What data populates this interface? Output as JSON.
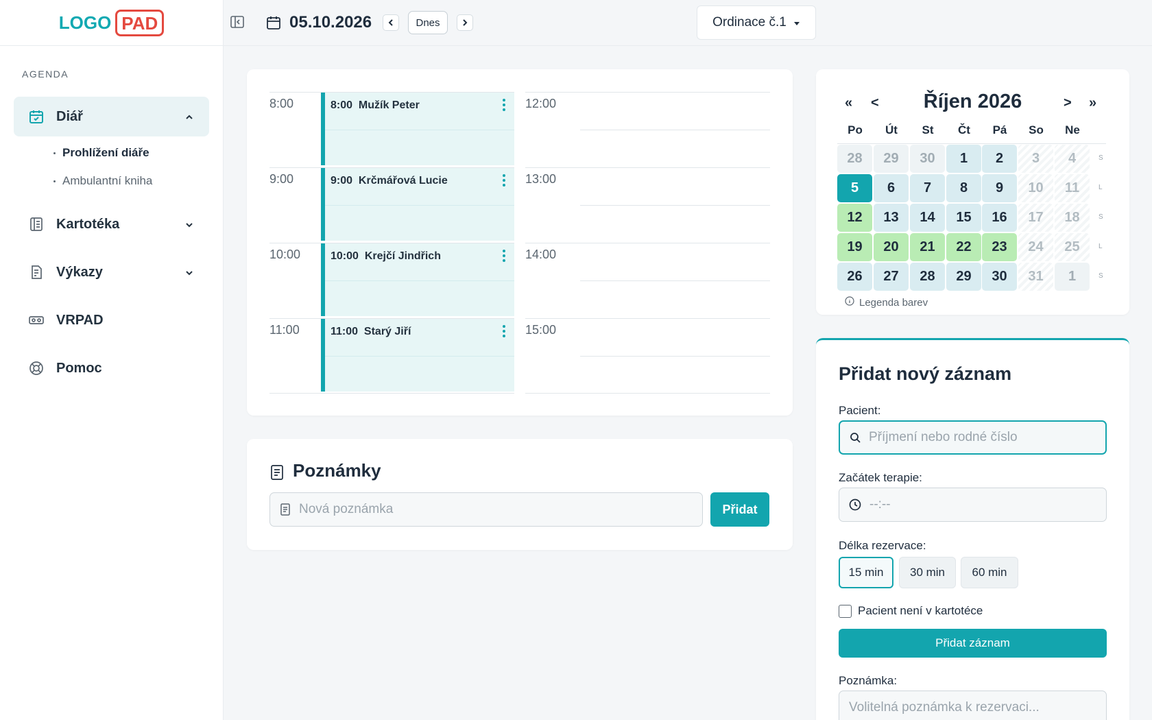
{
  "brand": {
    "logo_part1": "LOGO",
    "logo_part2": "PAD"
  },
  "sidebar": {
    "section_label": "AGENDA",
    "items": [
      {
        "label": "Diář",
        "icon": "calendar-check-icon",
        "expanded": true
      },
      {
        "label": "Kartotéka",
        "icon": "book-icon"
      },
      {
        "label": "Výkazy",
        "icon": "report-icon"
      },
      {
        "label": "VRPAD",
        "icon": "vr-headset-icon"
      },
      {
        "label": "Pomoc",
        "icon": "lifebuoy-icon"
      }
    ],
    "subitems": [
      {
        "label": "Prohlížení diáře",
        "current": true
      },
      {
        "label": "Ambulantní kniha"
      }
    ]
  },
  "topbar": {
    "date": "05.10.2026",
    "today_label": "Dnes",
    "office_select": "Ordinace č.1"
  },
  "schedule": {
    "left": [
      {
        "time": "8:00",
        "appointment": "8:00  Mužík Peter"
      },
      {
        "time": "9:00",
        "appointment": "9:00  Krčmářová Lucie"
      },
      {
        "time": "10:00",
        "appointment": "10:00  Krejčí Jindřich"
      },
      {
        "time": "11:00",
        "appointment": "11:00  Starý Jiří"
      }
    ],
    "right": [
      {
        "time": "12:00"
      },
      {
        "time": "13:00"
      },
      {
        "time": "14:00"
      },
      {
        "time": "15:00"
      }
    ]
  },
  "notes": {
    "title": "Poznámky",
    "placeholder": "Nová poznámka",
    "add_label": "Přidat"
  },
  "calendar": {
    "nav_first": "«",
    "nav_prev": "<",
    "nav_next": ">",
    "nav_last": "»",
    "month_title": "Říjen 2026",
    "weekdays": [
      "Po",
      "Út",
      "St",
      "Čt",
      "Pá",
      "So",
      "Ne"
    ],
    "weeks": [
      {
        "days": [
          "28",
          "29",
          "30",
          "1",
          "2",
          "3",
          "4"
        ],
        "label": "S"
      },
      {
        "days": [
          "5",
          "6",
          "7",
          "8",
          "9",
          "10",
          "11"
        ],
        "label": "L"
      },
      {
        "days": [
          "12",
          "13",
          "14",
          "15",
          "16",
          "17",
          "18"
        ],
        "label": "S"
      },
      {
        "days": [
          "19",
          "20",
          "21",
          "22",
          "23",
          "24",
          "25"
        ],
        "label": "L"
      },
      {
        "days": [
          "26",
          "27",
          "28",
          "29",
          "30",
          "31",
          "1"
        ],
        "label": "S"
      }
    ],
    "legend_label": "Legenda barev",
    "colors": {
      "selected": "#13a5ae",
      "green": "#b9ecb4",
      "in_month": "#d9ecf1"
    }
  },
  "form": {
    "title": "Přidat nový záznam",
    "patient_label": "Pacient:",
    "patient_placeholder": "Příjmení nebo rodné číslo",
    "start_label": "Začátek terapie:",
    "start_placeholder": "--:--",
    "duration_label": "Délka rezervace:",
    "durations": [
      "15 min",
      "30 min",
      "60 min"
    ],
    "selected_duration": "15 min",
    "not_in_registry_label": "Pacient není v kartotéce",
    "submit_label": "Přidat záznam",
    "note_label": "Poznámka:",
    "note_placeholder": "Volitelná poznámka k rezervaci..."
  },
  "accent_color": "#13a5ae"
}
